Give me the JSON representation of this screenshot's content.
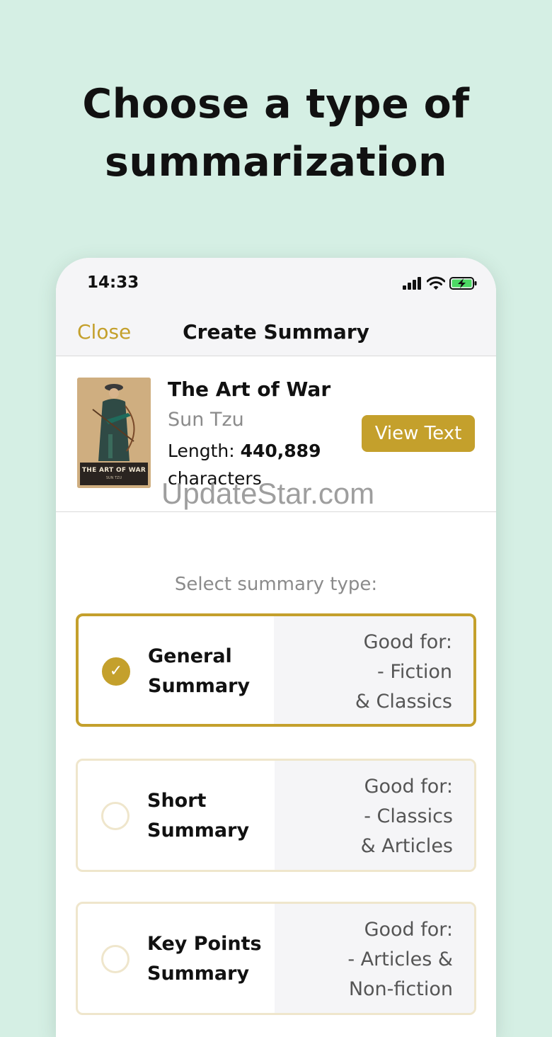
{
  "headline": {
    "line1": "Choose a type of",
    "line2": "summarization"
  },
  "status_bar": {
    "time": "14:33",
    "icons": [
      "signal-icon",
      "wifi-icon",
      "battery-charging-icon"
    ]
  },
  "nav": {
    "close_label": "Close",
    "title": "Create Summary"
  },
  "book": {
    "cover_title": "THE ART OF WAR",
    "cover_author": "SUN TZU",
    "title": "The Art of War",
    "author": "Sun Tzu",
    "length_label": "Length: ",
    "length_value": "440,889",
    "length_unit": "characters",
    "view_text_label": "View Text"
  },
  "watermark": "UpdateStar.com",
  "select_label": "Select summary type:",
  "options": [
    {
      "name_line1": "General",
      "name_line2": "Summary",
      "selected": true,
      "good_for": [
        "Good for:",
        "- Fiction",
        "& Classics"
      ]
    },
    {
      "name_line1": "Short",
      "name_line2": "Summary",
      "selected": false,
      "good_for": [
        "Good for:",
        "- Classics",
        "& Articles"
      ]
    },
    {
      "name_line1": "Key Points",
      "name_line2": "Summary",
      "selected": false,
      "good_for": [
        "Good for:",
        "- Articles &",
        "Non-fiction"
      ]
    }
  ],
  "colors": {
    "accent": "#c4a02c",
    "background": "#d5efe4",
    "unselected_border": "#efe6cc"
  }
}
